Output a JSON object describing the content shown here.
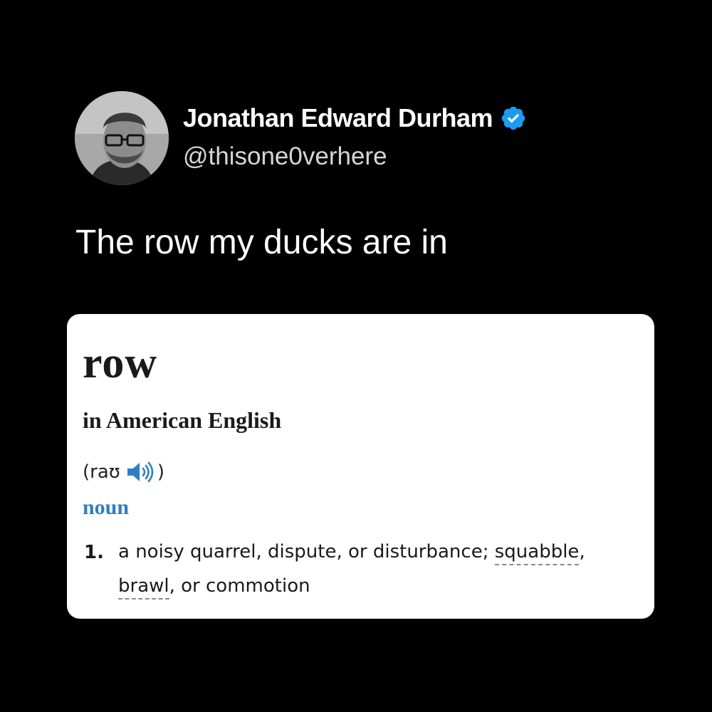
{
  "author": {
    "display_name": "Jonathan Edward Durham",
    "handle": "@thisone0verhere",
    "verified": true,
    "verified_color": "#1d9bf0",
    "avatar_icon": "avatar-photo"
  },
  "post": {
    "text": "The row my ducks are in"
  },
  "dictionary": {
    "headword": "row",
    "dialect": "in American English",
    "pronunciation_open": "(raʊ",
    "pronunciation_close": ")",
    "audio_icon": "speaker-icon",
    "part_of_speech": "noun",
    "part_of_speech_color": "#2f7ec1",
    "sense": {
      "number": "1.",
      "text_before": "a noisy quarrel, dispute, or disturbance; ",
      "link_1": "squabble",
      "text_between": ", ",
      "link_2": "brawl",
      "text_after": ", or commotion"
    }
  }
}
